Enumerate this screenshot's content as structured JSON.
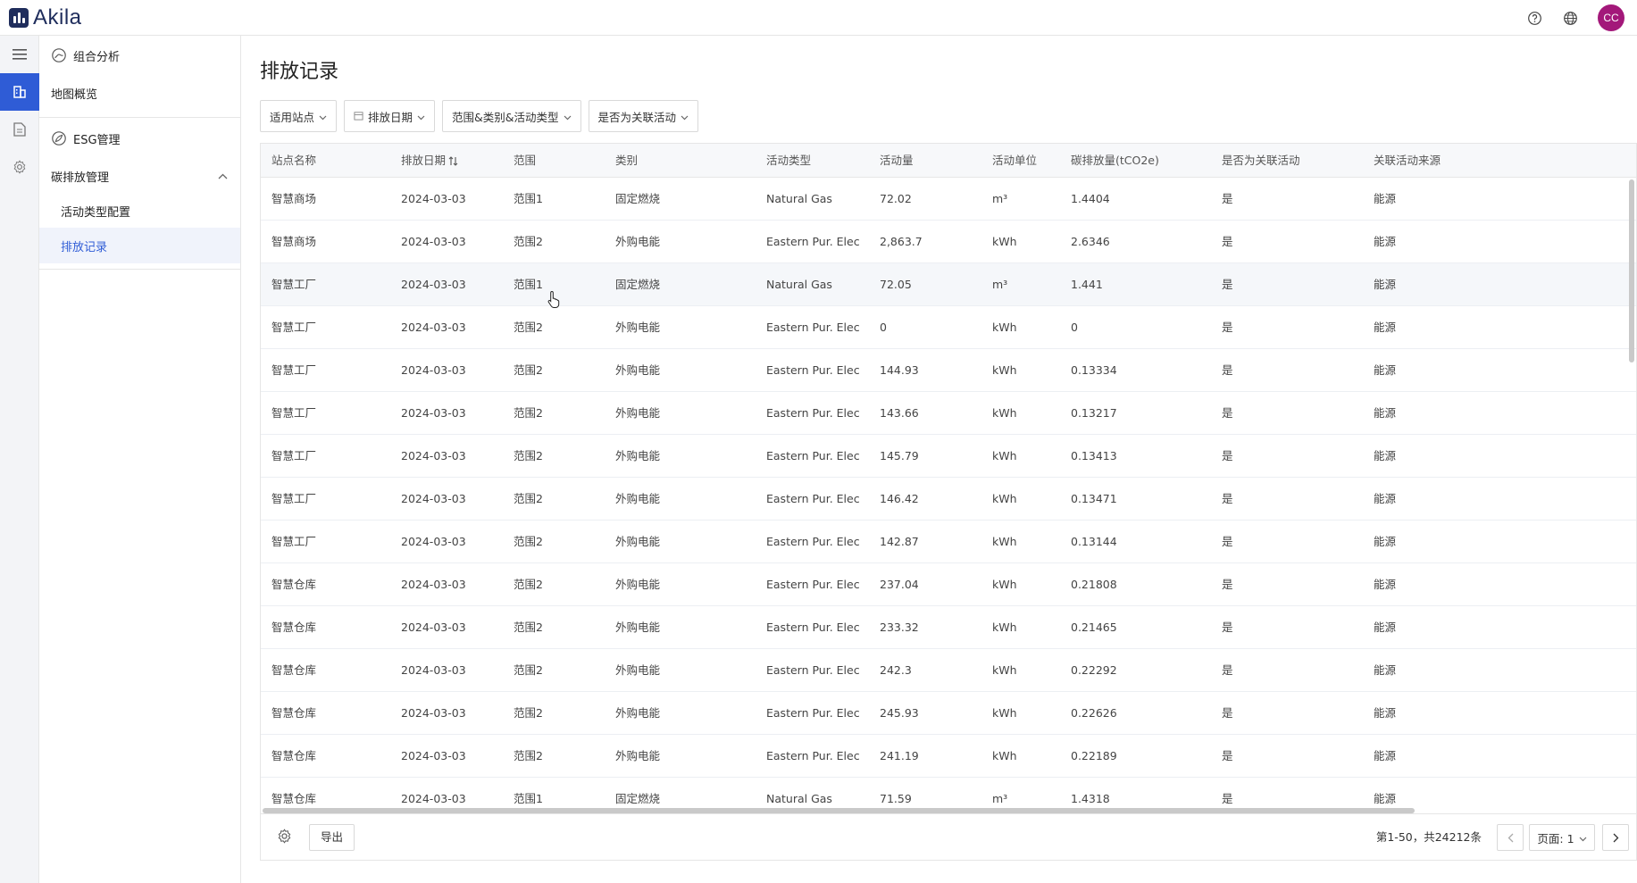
{
  "app": {
    "name": "Akila",
    "brand_color": "#1f2d5c",
    "accent_color": "#2f5cd6"
  },
  "header": {
    "avatar_initials": "CC",
    "avatar_color": "#a3187a",
    "icons": [
      "help-icon",
      "globe-icon"
    ]
  },
  "rail": {
    "icons": [
      "menu-icon",
      "building-icon",
      "document-icon",
      "gear-icon"
    ],
    "active_index": 1
  },
  "sidemenu": {
    "groups": [
      {
        "label": "组合分析",
        "icon": "analytics-icon",
        "items": [
          {
            "label": "地图概览"
          }
        ]
      },
      {
        "label": "ESG管理",
        "icon": "esg-icon",
        "items": [
          {
            "label": "碳排放管理",
            "expanded": true,
            "children": [
              {
                "label": "活动类型配置"
              },
              {
                "label": "排放记录",
                "active": true
              }
            ]
          }
        ]
      }
    ]
  },
  "page": {
    "title": "排放记录"
  },
  "filters": [
    {
      "label": "适用站点"
    },
    {
      "label": "排放日期"
    },
    {
      "label": "范围&类别&活动类型"
    },
    {
      "label": "是否为关联活动"
    }
  ],
  "table": {
    "columns": [
      "站点名称",
      "排放日期",
      "范围",
      "类别",
      "活动类型",
      "活动量",
      "活动单位",
      "碳排放量(tCO2e)",
      "是否为关联活动",
      "关联活动来源"
    ],
    "rows": [
      [
        "智慧商场",
        "2024-03-03",
        "范围1",
        "固定燃烧",
        "Natural Gas",
        "72.02",
        "m³",
        "1.4404",
        "是",
        "能源"
      ],
      [
        "智慧商场",
        "2024-03-03",
        "范围2",
        "外购电能",
        "Eastern Pur. Elec",
        "2,863.7",
        "kWh",
        "2.6346",
        "是",
        "能源"
      ],
      [
        "智慧工厂",
        "2024-03-03",
        "范围1",
        "固定燃烧",
        "Natural Gas",
        "72.05",
        "m³",
        "1.441",
        "是",
        "能源"
      ],
      [
        "智慧工厂",
        "2024-03-03",
        "范围2",
        "外购电能",
        "Eastern Pur. Elec",
        "0",
        "kWh",
        "0",
        "是",
        "能源"
      ],
      [
        "智慧工厂",
        "2024-03-03",
        "范围2",
        "外购电能",
        "Eastern Pur. Elec",
        "144.93",
        "kWh",
        "0.13334",
        "是",
        "能源"
      ],
      [
        "智慧工厂",
        "2024-03-03",
        "范围2",
        "外购电能",
        "Eastern Pur. Elec",
        "143.66",
        "kWh",
        "0.13217",
        "是",
        "能源"
      ],
      [
        "智慧工厂",
        "2024-03-03",
        "范围2",
        "外购电能",
        "Eastern Pur. Elec",
        "145.79",
        "kWh",
        "0.13413",
        "是",
        "能源"
      ],
      [
        "智慧工厂",
        "2024-03-03",
        "范围2",
        "外购电能",
        "Eastern Pur. Elec",
        "146.42",
        "kWh",
        "0.13471",
        "是",
        "能源"
      ],
      [
        "智慧工厂",
        "2024-03-03",
        "范围2",
        "外购电能",
        "Eastern Pur. Elec",
        "142.87",
        "kWh",
        "0.13144",
        "是",
        "能源"
      ],
      [
        "智慧仓库",
        "2024-03-03",
        "范围2",
        "外购电能",
        "Eastern Pur. Elec",
        "237.04",
        "kWh",
        "0.21808",
        "是",
        "能源"
      ],
      [
        "智慧仓库",
        "2024-03-03",
        "范围2",
        "外购电能",
        "Eastern Pur. Elec",
        "233.32",
        "kWh",
        "0.21465",
        "是",
        "能源"
      ],
      [
        "智慧仓库",
        "2024-03-03",
        "范围2",
        "外购电能",
        "Eastern Pur. Elec",
        "242.3",
        "kWh",
        "0.22292",
        "是",
        "能源"
      ],
      [
        "智慧仓库",
        "2024-03-03",
        "范围2",
        "外购电能",
        "Eastern Pur. Elec",
        "245.93",
        "kWh",
        "0.22626",
        "是",
        "能源"
      ],
      [
        "智慧仓库",
        "2024-03-03",
        "范围2",
        "外购电能",
        "Eastern Pur. Elec",
        "241.19",
        "kWh",
        "0.22189",
        "是",
        "能源"
      ],
      [
        "智慧仓库",
        "2024-03-03",
        "范围1",
        "固定燃烧",
        "Natural Gas",
        "71.59",
        "m³",
        "1.4318",
        "是",
        "能源"
      ]
    ],
    "hover_row_index": 2
  },
  "footer": {
    "export_label": "导出",
    "range_text": "第1-50，共24212条",
    "page_label": "页面: 1"
  }
}
